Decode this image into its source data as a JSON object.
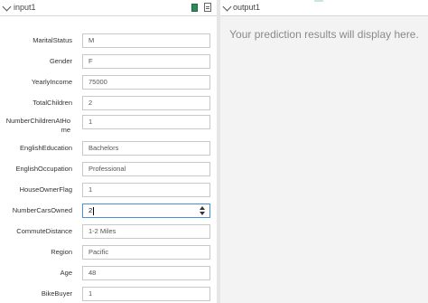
{
  "input_panel": {
    "title": "input1",
    "fields": [
      {
        "label": "MaritalStatus",
        "value": "M"
      },
      {
        "label": "Gender",
        "value": "F"
      },
      {
        "label": "YearlyIncome",
        "value": "75000"
      },
      {
        "label": "TotalChildren",
        "value": "2"
      },
      {
        "label": "NumberChildrenAtHome",
        "value": "1"
      },
      {
        "label": "EnglishEducation",
        "value": "Bachelors"
      },
      {
        "label": "EnglishOccupation",
        "value": "Professional"
      },
      {
        "label": "HouseOwnerFlag",
        "value": "1"
      },
      {
        "label": "NumberCarsOwned",
        "value": "2"
      },
      {
        "label": "CommuteDistance",
        "value": "1-2 Miles"
      },
      {
        "label": "Region",
        "value": "Pacific"
      },
      {
        "label": "Age",
        "value": "48"
      },
      {
        "label": "BikeBuyer",
        "value": "1"
      }
    ],
    "icons": [
      "table-icon",
      "document-icon"
    ]
  },
  "output_panel": {
    "title": "output1",
    "placeholder": "Your prediction results will display here."
  },
  "colors": {
    "focus_border": "#4a90d9",
    "output_background": "#f3f3f3",
    "accent_icon": "#2e8a5c"
  }
}
